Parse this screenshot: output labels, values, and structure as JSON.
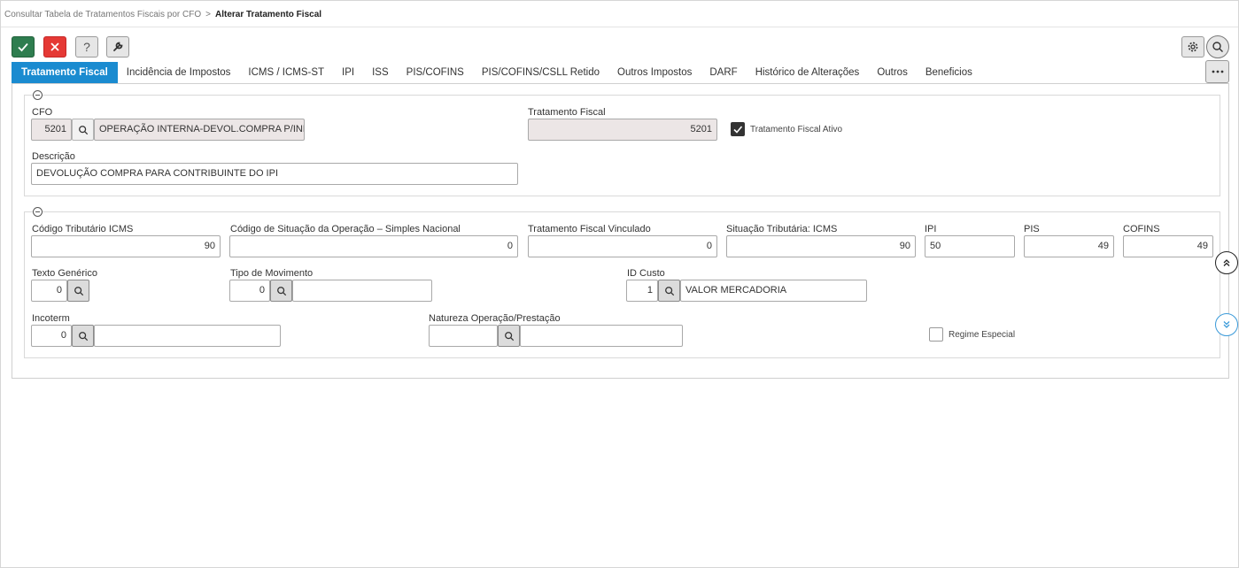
{
  "breadcrumb": {
    "parent": "Consultar Tabela de Tratamentos Fiscais por CFO",
    "separator": ">",
    "current": "Alterar Tratamento Fiscal"
  },
  "toolbar": {
    "help_label": "?"
  },
  "tabs": [
    {
      "label": "Tratamento Fiscal",
      "active": true
    },
    {
      "label": "Incidência de Impostos"
    },
    {
      "label": "ICMS / ICMS-ST"
    },
    {
      "label": "IPI"
    },
    {
      "label": "ISS"
    },
    {
      "label": "PIS/COFINS"
    },
    {
      "label": "PIS/COFINS/CSLL Retido"
    },
    {
      "label": "Outros Impostos"
    },
    {
      "label": "DARF"
    },
    {
      "label": "Histórico de Alterações"
    },
    {
      "label": "Outros"
    },
    {
      "label": "Beneficios"
    }
  ],
  "section1": {
    "cfo": {
      "label": "CFO",
      "code": "5201",
      "description": "OPERAÇÃO INTERNA-DEVOL.COMPRA P/INDUS"
    },
    "tratamento_fiscal": {
      "label": "Tratamento Fiscal",
      "value": "5201"
    },
    "ativo": {
      "label": "Tratamento Fiscal Ativo",
      "checked": true
    },
    "descricao": {
      "label": "Descrição",
      "value": "DEVOLUÇÃO COMPRA PARA CONTRIBUINTE DO IPI"
    }
  },
  "section2": {
    "codigo_tributario_icms": {
      "label": "Código Tributário ICMS",
      "value": "90"
    },
    "csosn": {
      "label": "Código de Situação da Operação – Simples Nacional",
      "value": "0"
    },
    "tf_vinculado": {
      "label": "Tratamento Fiscal Vinculado",
      "value": "0"
    },
    "situacao_icms": {
      "label": "Situação Tributária: ICMS",
      "value": "90"
    },
    "ipi": {
      "label": "IPI",
      "value": "50"
    },
    "pis": {
      "label": "PIS",
      "value": "49"
    },
    "cofins": {
      "label": "COFINS",
      "value": "49"
    },
    "texto_generico": {
      "label": "Texto Genérico",
      "value": "0"
    },
    "tipo_movimento": {
      "label": "Tipo de Movimento",
      "value": "0",
      "description": ""
    },
    "id_custo": {
      "label": "ID Custo",
      "value": "1",
      "description": "VALOR MERCADORIA"
    },
    "incoterm": {
      "label": "Incoterm",
      "value": "0",
      "description": ""
    },
    "natureza": {
      "label": "Natureza Operação/Prestação",
      "value": "",
      "description": ""
    },
    "regime_especial": {
      "label": "Regime Especial",
      "checked": false
    }
  },
  "colors": {
    "accent": "#1a8bd0",
    "ok": "#2e7d4f",
    "cancel": "#e53935",
    "readonly_bg": "#ece6e6"
  },
  "icons": [
    "check-icon",
    "close-icon",
    "help-icon",
    "wrench-icon",
    "gear-icon",
    "search-icon",
    "more-icon",
    "chevrons-up-icon",
    "chevrons-down-icon",
    "collapse-icon"
  ]
}
